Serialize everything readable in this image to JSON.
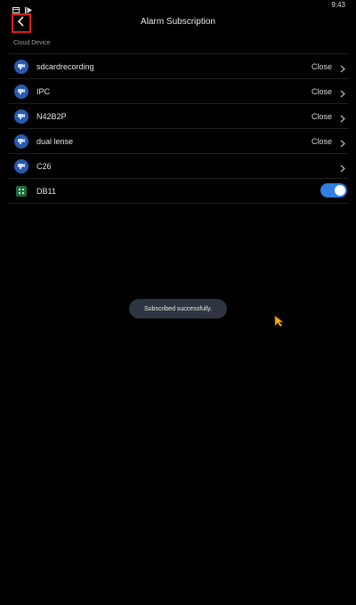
{
  "status_bar": {
    "time": "9:43",
    "icons": [
      "calendar-icon",
      "play-icon"
    ]
  },
  "header": {
    "title": "Alarm Subscription",
    "back_icon": "chevron-left-icon"
  },
  "section": {
    "label": "Cloud Device"
  },
  "devices": [
    {
      "name": "sdcardrecording",
      "status": "Close",
      "icon": "camera-icon"
    },
    {
      "name": "IPC",
      "status": "Close",
      "icon": "camera-icon"
    },
    {
      "name": "N42B2P",
      "status": "Close",
      "icon": "camera-icon"
    },
    {
      "name": "dual lense",
      "status": "Close",
      "icon": "camera-icon"
    },
    {
      "name": "C26",
      "status": "",
      "icon": "camera-icon"
    },
    {
      "name": "DB11",
      "status": "",
      "icon": "doorbell-icon",
      "toggle_on": true
    }
  ],
  "toast": {
    "text": "Subscribed successfully."
  },
  "colors": {
    "background": "#000000",
    "accent": "#2f7ee0",
    "highlight": "#e01c1c",
    "toast_bg": "#2c3540"
  }
}
